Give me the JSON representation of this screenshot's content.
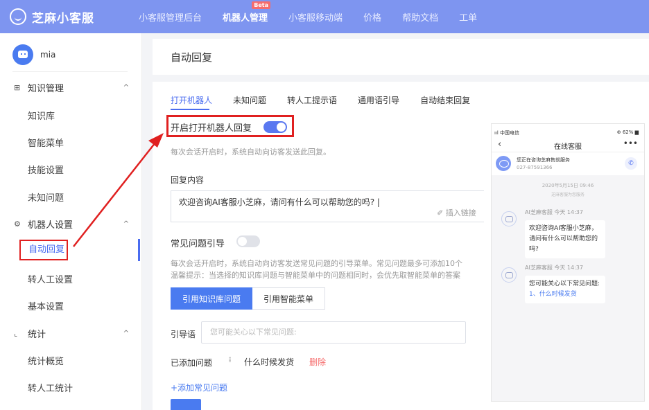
{
  "topbar": {
    "logo": "芝麻小客服",
    "nav": [
      {
        "label": "小客服管理后台"
      },
      {
        "label": "机器人管理",
        "badge": "Beta"
      },
      {
        "label": "小客服移动端"
      },
      {
        "label": "价格"
      },
      {
        "label": "帮助文档"
      },
      {
        "label": "工单"
      }
    ]
  },
  "sidebar": {
    "user": "mia",
    "groups": [
      {
        "label": "知识管理",
        "items": [
          "知识库",
          "智能菜单",
          "技能设置",
          "未知问题"
        ]
      },
      {
        "label": "机器人设置",
        "items": [
          "自动回复",
          "转人工设置",
          "基本设置"
        ]
      },
      {
        "label": "统计",
        "items": [
          "统计概览",
          "转人工统计"
        ]
      }
    ]
  },
  "main": {
    "title": "自动回复",
    "tabs": [
      "打开机器人",
      "未知问题",
      "转人工提示语",
      "通用语引导",
      "自动结束回复"
    ],
    "toggle_label": "开启打开机器人回复",
    "toggle_on": true,
    "toggle_hint": "每次会话开启时，系统自动向访客发送此回复。",
    "reply_label": "回复内容",
    "reply_text": "欢迎咨询AI客服小芝麻，请问有什么可以帮助您的吗? |",
    "insert_link": "✐ 插入链接",
    "faq_label": "常见问题引导",
    "faq_on": false,
    "faq_hint1": "每次会话开启时，系统自动向访客发送常见问题的引导菜单。常见问题最多可添加10个",
    "faq_hint2": "温馨提示：当选择的知识库问题与智能菜单中的问题相同时，会优先取智能菜单的答案",
    "btn_knowledge": "引用知识库问题",
    "btn_menu": "引用智能菜单",
    "guide_label": "引导语",
    "guide_placeholder": "您可能关心以下常见问题:",
    "added_label": "已添加问题",
    "added_question": "什么时候发货",
    "delete": "删除",
    "add_faq": "+添加常见问题"
  },
  "phone": {
    "status_left": "ııl 中国电信",
    "status_right": "⊕ 62% ▆",
    "back": "‹",
    "title": "在线客服",
    "more": "•••",
    "service_title": "您正在咨询芝麻售前服务",
    "service_phone": "027-87591366",
    "phone_icon": "✆",
    "date": "2020年5月15日 09:46",
    "note": "芝麻客服为您服务",
    "msg1_name": "AI芝麻客服 今天 14:37",
    "msg1_text": "欢迎咨询AI客服小芝麻，请问有什么可以帮助您的吗?",
    "msg2_name": "AI芝麻客服 今天 14:37",
    "msg2_text": "您可能关心以下常见问题:",
    "msg2_link": "1、什么时候发货"
  }
}
